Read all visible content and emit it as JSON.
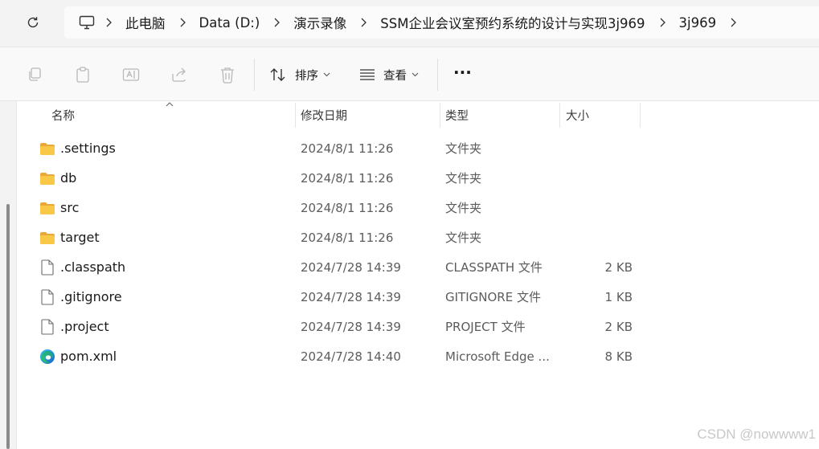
{
  "breadcrumb": {
    "items": [
      {
        "label": "此电脑"
      },
      {
        "label": "Data (D:)"
      },
      {
        "label": "演示录像"
      },
      {
        "label": "SSM企业会议室预约系统的设计与实现3j969"
      },
      {
        "label": "3j969"
      }
    ]
  },
  "toolbar": {
    "sort_label": "排序",
    "view_label": "查看",
    "more_label": "···"
  },
  "columns": {
    "name": "名称",
    "date": "修改日期",
    "type": "类型",
    "size": "大小"
  },
  "files": [
    {
      "name": ".settings",
      "date": "2024/8/1 11:26",
      "type": "文件夹",
      "size": "",
      "icon": "folder-icon"
    },
    {
      "name": "db",
      "date": "2024/8/1 11:26",
      "type": "文件夹",
      "size": "",
      "icon": "folder-icon"
    },
    {
      "name": "src",
      "date": "2024/8/1 11:26",
      "type": "文件夹",
      "size": "",
      "icon": "folder-icon"
    },
    {
      "name": "target",
      "date": "2024/8/1 11:26",
      "type": "文件夹",
      "size": "",
      "icon": "folder-icon"
    },
    {
      "name": ".classpath",
      "date": "2024/7/28 14:39",
      "type": "CLASSPATH 文件",
      "size": "2 KB",
      "icon": "file-icon"
    },
    {
      "name": ".gitignore",
      "date": "2024/7/28 14:39",
      "type": "GITIGNORE 文件",
      "size": "1 KB",
      "icon": "file-icon"
    },
    {
      "name": ".project",
      "date": "2024/7/28 14:39",
      "type": "PROJECT 文件",
      "size": "2 KB",
      "icon": "file-icon"
    },
    {
      "name": "pom.xml",
      "date": "2024/7/28 14:40",
      "type": "Microsoft Edge ...",
      "size": "8 KB",
      "icon": "edge-icon"
    }
  ],
  "watermark": "CSDN @nowwww1",
  "colors": {
    "folder": "#f5c542",
    "accent": "#0067c0",
    "background": "#f3f3f3"
  }
}
